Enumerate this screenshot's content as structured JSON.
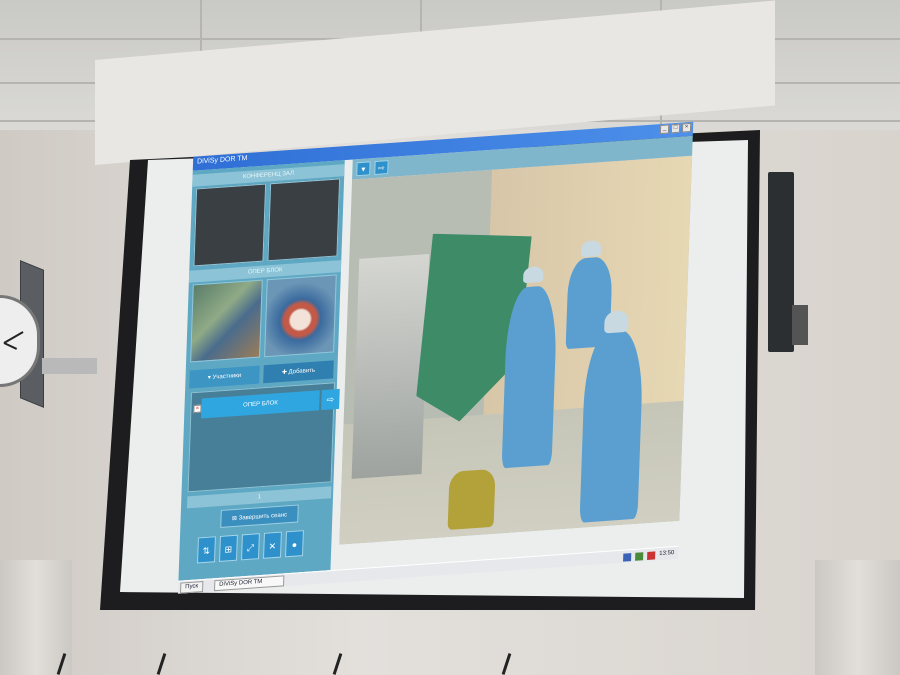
{
  "app": {
    "title": "DiViSy DOR TM",
    "window_buttons": [
      "_",
      "□",
      "×"
    ]
  },
  "left_panel": {
    "conference_label": "КОНФЕРЕНЦ ЗАЛ",
    "operating_label": "ОПЕР БЛОК",
    "tabs": {
      "participants": "Участники",
      "add": "Добавить"
    },
    "list_item": "ОПЕР БЛОК",
    "pager": "1",
    "end_session": "Завершить сеанс"
  },
  "taskbar": {
    "start": "Пуск",
    "task_item": "DiViSy DOR TM",
    "clock": "13:50"
  },
  "colors": {
    "panel": "#5ea8c4",
    "button": "#2fa6e0",
    "titlebar": "#2f6fd6"
  }
}
